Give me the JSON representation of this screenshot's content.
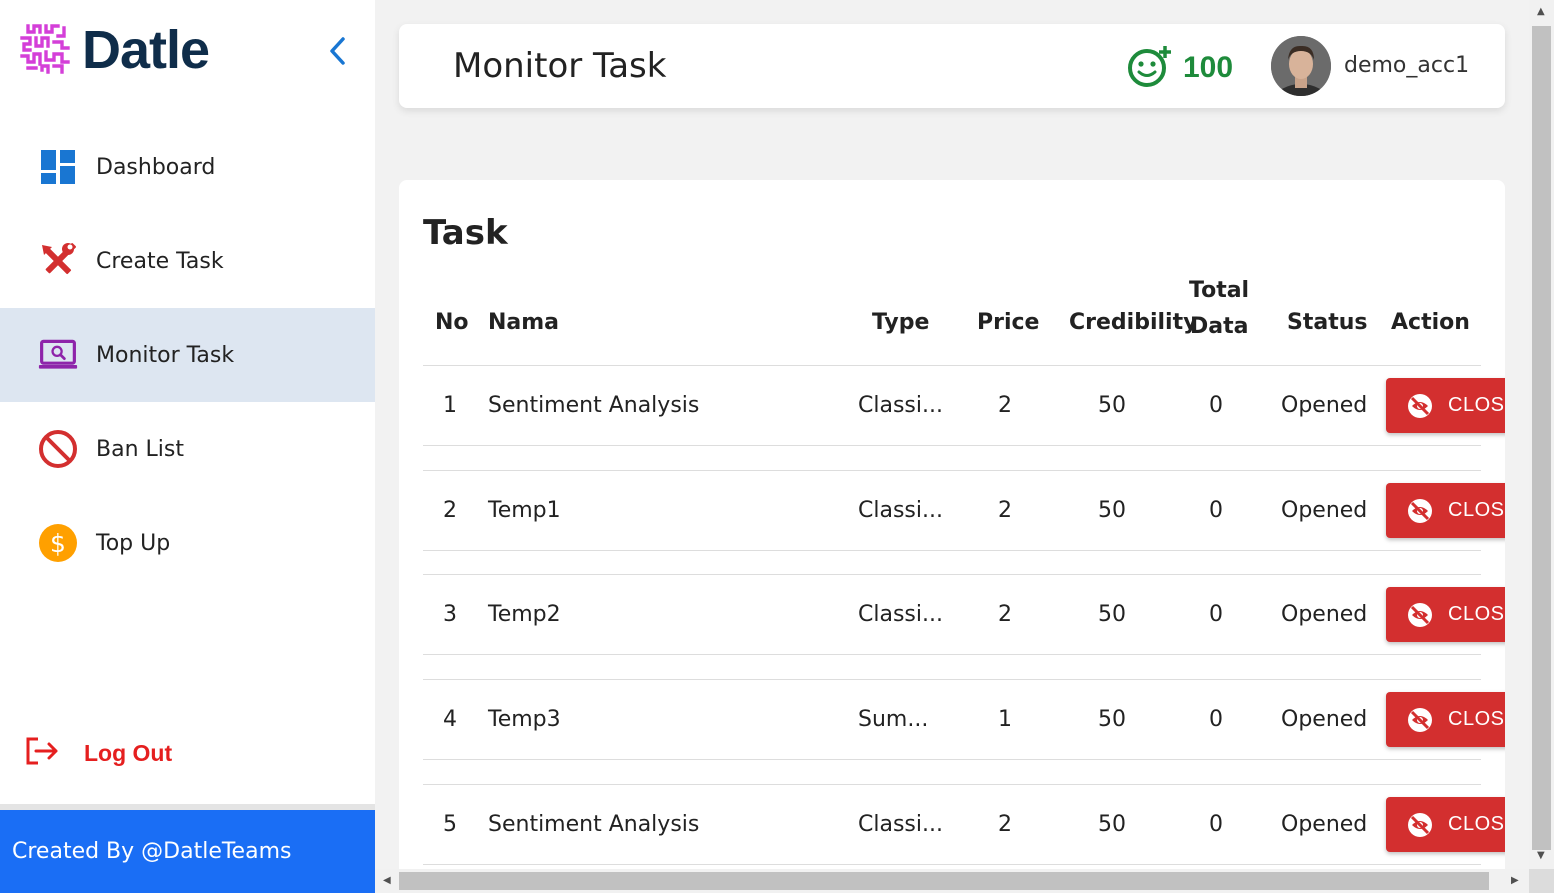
{
  "brand": {
    "name": "Datle"
  },
  "sidebar": {
    "items": [
      {
        "label": "Dashboard",
        "icon": "dashboard-icon"
      },
      {
        "label": "Create Task",
        "icon": "tools-icon"
      },
      {
        "label": "Monitor Task",
        "icon": "monitor-icon",
        "active": true
      },
      {
        "label": "Ban List",
        "icon": "ban-icon"
      },
      {
        "label": "Top Up",
        "icon": "dollar-icon"
      }
    ],
    "logout_label": "Log Out",
    "credit": "Created By @DatleTeams"
  },
  "header": {
    "title": "Monitor Task",
    "points": "100",
    "username": "demo_acc1"
  },
  "table": {
    "title": "Task",
    "columns": {
      "no": "No",
      "nama": "Nama",
      "type": "Type",
      "price": "Price",
      "credibility": "Credibility",
      "total_line1": "Total",
      "total_line2": "Data",
      "status": "Status",
      "action": "Action"
    },
    "rows": [
      {
        "no": "1",
        "nama": "Sentiment Analysis",
        "type": "Classi...",
        "price": "2",
        "credibility": "50",
        "total": "0",
        "status": "Opened",
        "action": "CLOSE"
      },
      {
        "no": "2",
        "nama": "Temp1",
        "type": "Classi...",
        "price": "2",
        "credibility": "50",
        "total": "0",
        "status": "Opened",
        "action": "CLOSE"
      },
      {
        "no": "3",
        "nama": "Temp2",
        "type": "Classi...",
        "price": "2",
        "credibility": "50",
        "total": "0",
        "status": "Opened",
        "action": "CLOSE"
      },
      {
        "no": "4",
        "nama": "Temp3",
        "type": "Sum...",
        "price": "1",
        "credibility": "50",
        "total": "0",
        "status": "Opened",
        "action": "CLOSE"
      },
      {
        "no": "5",
        "nama": "Sentiment Analysis",
        "type": "Classi...",
        "price": "2",
        "credibility": "50",
        "total": "0",
        "status": "Opened",
        "action": "CLOSE"
      }
    ]
  },
  "colors": {
    "accent_blue": "#1a6ef5",
    "danger_red": "#d32f2f",
    "points_green": "#1e8b3b",
    "logout_red": "#e51f1f",
    "active_bg": "#dde6f1"
  }
}
